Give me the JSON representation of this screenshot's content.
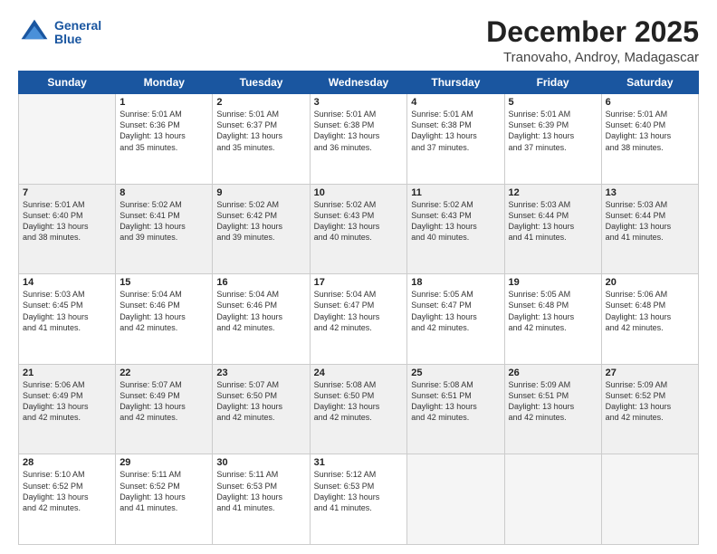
{
  "logo": {
    "line1": "General",
    "line2": "Blue"
  },
  "header": {
    "month": "December 2025",
    "location": "Tranovaho, Androy, Madagascar"
  },
  "days_of_week": [
    "Sunday",
    "Monday",
    "Tuesday",
    "Wednesday",
    "Thursday",
    "Friday",
    "Saturday"
  ],
  "weeks": [
    [
      {
        "day": "",
        "sunrise": "",
        "sunset": "",
        "daylight": ""
      },
      {
        "day": "1",
        "sunrise": "Sunrise: 5:01 AM",
        "sunset": "Sunset: 6:36 PM",
        "daylight": "Daylight: 13 hours and 35 minutes."
      },
      {
        "day": "2",
        "sunrise": "Sunrise: 5:01 AM",
        "sunset": "Sunset: 6:37 PM",
        "daylight": "Daylight: 13 hours and 35 minutes."
      },
      {
        "day": "3",
        "sunrise": "Sunrise: 5:01 AM",
        "sunset": "Sunset: 6:38 PM",
        "daylight": "Daylight: 13 hours and 36 minutes."
      },
      {
        "day": "4",
        "sunrise": "Sunrise: 5:01 AM",
        "sunset": "Sunset: 6:38 PM",
        "daylight": "Daylight: 13 hours and 37 minutes."
      },
      {
        "day": "5",
        "sunrise": "Sunrise: 5:01 AM",
        "sunset": "Sunset: 6:39 PM",
        "daylight": "Daylight: 13 hours and 37 minutes."
      },
      {
        "day": "6",
        "sunrise": "Sunrise: 5:01 AM",
        "sunset": "Sunset: 6:40 PM",
        "daylight": "Daylight: 13 hours and 38 minutes."
      }
    ],
    [
      {
        "day": "7",
        "sunrise": "Sunrise: 5:01 AM",
        "sunset": "Sunset: 6:40 PM",
        "daylight": "Daylight: 13 hours and 38 minutes."
      },
      {
        "day": "8",
        "sunrise": "Sunrise: 5:02 AM",
        "sunset": "Sunset: 6:41 PM",
        "daylight": "Daylight: 13 hours and 39 minutes."
      },
      {
        "day": "9",
        "sunrise": "Sunrise: 5:02 AM",
        "sunset": "Sunset: 6:42 PM",
        "daylight": "Daylight: 13 hours and 39 minutes."
      },
      {
        "day": "10",
        "sunrise": "Sunrise: 5:02 AM",
        "sunset": "Sunset: 6:43 PM",
        "daylight": "Daylight: 13 hours and 40 minutes."
      },
      {
        "day": "11",
        "sunrise": "Sunrise: 5:02 AM",
        "sunset": "Sunset: 6:43 PM",
        "daylight": "Daylight: 13 hours and 40 minutes."
      },
      {
        "day": "12",
        "sunrise": "Sunrise: 5:03 AM",
        "sunset": "Sunset: 6:44 PM",
        "daylight": "Daylight: 13 hours and 41 minutes."
      },
      {
        "day": "13",
        "sunrise": "Sunrise: 5:03 AM",
        "sunset": "Sunset: 6:44 PM",
        "daylight": "Daylight: 13 hours and 41 minutes."
      }
    ],
    [
      {
        "day": "14",
        "sunrise": "Sunrise: 5:03 AM",
        "sunset": "Sunset: 6:45 PM",
        "daylight": "Daylight: 13 hours and 41 minutes."
      },
      {
        "day": "15",
        "sunrise": "Sunrise: 5:04 AM",
        "sunset": "Sunset: 6:46 PM",
        "daylight": "Daylight: 13 hours and 42 minutes."
      },
      {
        "day": "16",
        "sunrise": "Sunrise: 5:04 AM",
        "sunset": "Sunset: 6:46 PM",
        "daylight": "Daylight: 13 hours and 42 minutes."
      },
      {
        "day": "17",
        "sunrise": "Sunrise: 5:04 AM",
        "sunset": "Sunset: 6:47 PM",
        "daylight": "Daylight: 13 hours and 42 minutes."
      },
      {
        "day": "18",
        "sunrise": "Sunrise: 5:05 AM",
        "sunset": "Sunset: 6:47 PM",
        "daylight": "Daylight: 13 hours and 42 minutes."
      },
      {
        "day": "19",
        "sunrise": "Sunrise: 5:05 AM",
        "sunset": "Sunset: 6:48 PM",
        "daylight": "Daylight: 13 hours and 42 minutes."
      },
      {
        "day": "20",
        "sunrise": "Sunrise: 5:06 AM",
        "sunset": "Sunset: 6:48 PM",
        "daylight": "Daylight: 13 hours and 42 minutes."
      }
    ],
    [
      {
        "day": "21",
        "sunrise": "Sunrise: 5:06 AM",
        "sunset": "Sunset: 6:49 PM",
        "daylight": "Daylight: 13 hours and 42 minutes."
      },
      {
        "day": "22",
        "sunrise": "Sunrise: 5:07 AM",
        "sunset": "Sunset: 6:49 PM",
        "daylight": "Daylight: 13 hours and 42 minutes."
      },
      {
        "day": "23",
        "sunrise": "Sunrise: 5:07 AM",
        "sunset": "Sunset: 6:50 PM",
        "daylight": "Daylight: 13 hours and 42 minutes."
      },
      {
        "day": "24",
        "sunrise": "Sunrise: 5:08 AM",
        "sunset": "Sunset: 6:50 PM",
        "daylight": "Daylight: 13 hours and 42 minutes."
      },
      {
        "day": "25",
        "sunrise": "Sunrise: 5:08 AM",
        "sunset": "Sunset: 6:51 PM",
        "daylight": "Daylight: 13 hours and 42 minutes."
      },
      {
        "day": "26",
        "sunrise": "Sunrise: 5:09 AM",
        "sunset": "Sunset: 6:51 PM",
        "daylight": "Daylight: 13 hours and 42 minutes."
      },
      {
        "day": "27",
        "sunrise": "Sunrise: 5:09 AM",
        "sunset": "Sunset: 6:52 PM",
        "daylight": "Daylight: 13 hours and 42 minutes."
      }
    ],
    [
      {
        "day": "28",
        "sunrise": "Sunrise: 5:10 AM",
        "sunset": "Sunset: 6:52 PM",
        "daylight": "Daylight: 13 hours and 42 minutes."
      },
      {
        "day": "29",
        "sunrise": "Sunrise: 5:11 AM",
        "sunset": "Sunset: 6:52 PM",
        "daylight": "Daylight: 13 hours and 41 minutes."
      },
      {
        "day": "30",
        "sunrise": "Sunrise: 5:11 AM",
        "sunset": "Sunset: 6:53 PM",
        "daylight": "Daylight: 13 hours and 41 minutes."
      },
      {
        "day": "31",
        "sunrise": "Sunrise: 5:12 AM",
        "sunset": "Sunset: 6:53 PM",
        "daylight": "Daylight: 13 hours and 41 minutes."
      },
      {
        "day": "",
        "sunrise": "",
        "sunset": "",
        "daylight": ""
      },
      {
        "day": "",
        "sunrise": "",
        "sunset": "",
        "daylight": ""
      },
      {
        "day": "",
        "sunrise": "",
        "sunset": "",
        "daylight": ""
      }
    ]
  ]
}
